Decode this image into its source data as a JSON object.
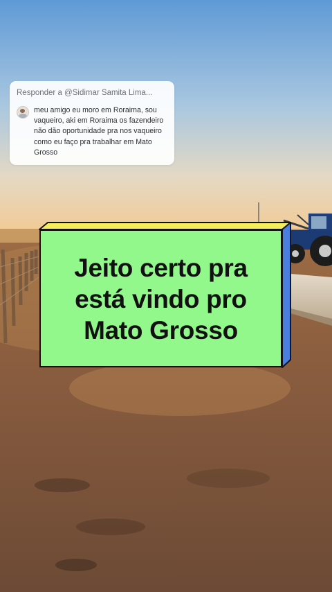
{
  "reply_card": {
    "header": "Responder a @Sidimar Samita Lima...",
    "comment": "meu amigo eu moro em Roraima, sou vaqueiro, aki em Roraima os fazendeiro não dão oportunidade pra nos vaqueiro como eu faço pra trabalhar em Mato Grosso"
  },
  "overlay": {
    "lines": [
      "Jeito certo pra",
      "está vindo pro",
      "Mato Grosso"
    ]
  },
  "colors": {
    "caption_box": "#92f88c",
    "caption_top_edge": "#f5ee5a",
    "caption_side_edge": "#4a7fe0"
  },
  "icons": [
    "avatar"
  ]
}
